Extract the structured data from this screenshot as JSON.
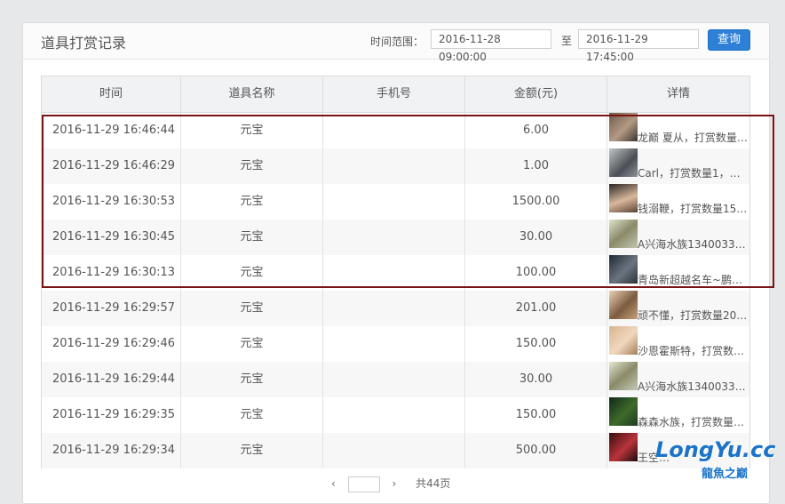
{
  "panel": {
    "title": "道具打赏记录",
    "range_label": "时间范围：",
    "start_date": "2016-11-28 09:00:00",
    "to_label": "至",
    "end_date": "2016-11-29 17:45:00",
    "query_label": "查询"
  },
  "table": {
    "headers": [
      "时间",
      "道具名称",
      "手机号",
      "金额(元)",
      "详情"
    ],
    "rows": [
      {
        "time": "2016-11-29 16:46:44",
        "item": "元宝",
        "phone": "",
        "amount": "6.00",
        "detail": "龙巅 夏从，打赏数量…"
      },
      {
        "time": "2016-11-29 16:46:29",
        "item": "元宝",
        "phone": "",
        "amount": "1.00",
        "detail": "Carl，打赏数量1，总…"
      },
      {
        "time": "2016-11-29 16:30:53",
        "item": "元宝",
        "phone": "",
        "amount": "1500.00",
        "detail": "钱溺鞭，打赏数量15…"
      },
      {
        "time": "2016-11-29 16:30:45",
        "item": "元宝",
        "phone": "",
        "amount": "30.00",
        "detail": "A兴海水族13400337…"
      },
      {
        "time": "2016-11-29 16:30:13",
        "item": "元宝",
        "phone": "",
        "amount": "100.00",
        "detail": "青岛新超越名车~鹏…"
      },
      {
        "time": "2016-11-29 16:29:57",
        "item": "元宝",
        "phone": "",
        "amount": "201.00",
        "detail": "顽不懂，打赏数量20…"
      },
      {
        "time": "2016-11-29 16:29:46",
        "item": "元宝",
        "phone": "",
        "amount": "150.00",
        "detail": "沙恩霍斯特，打赏数…"
      },
      {
        "time": "2016-11-29 16:29:44",
        "item": "元宝",
        "phone": "",
        "amount": "30.00",
        "detail": "A兴海水族13400337…"
      },
      {
        "time": "2016-11-29 16:29:35",
        "item": "元宝",
        "phone": "",
        "amount": "150.00",
        "detail": "森森水族，打赏数量1…"
      },
      {
        "time": "2016-11-29 16:29:34",
        "item": "元宝",
        "phone": "",
        "amount": "500.00",
        "detail": "王空…"
      }
    ]
  },
  "pager": {
    "prev": "‹",
    "next": "›",
    "total": "共44页"
  },
  "watermark": {
    "logo": "LongYu.cc",
    "sub": "龍魚之巅"
  }
}
